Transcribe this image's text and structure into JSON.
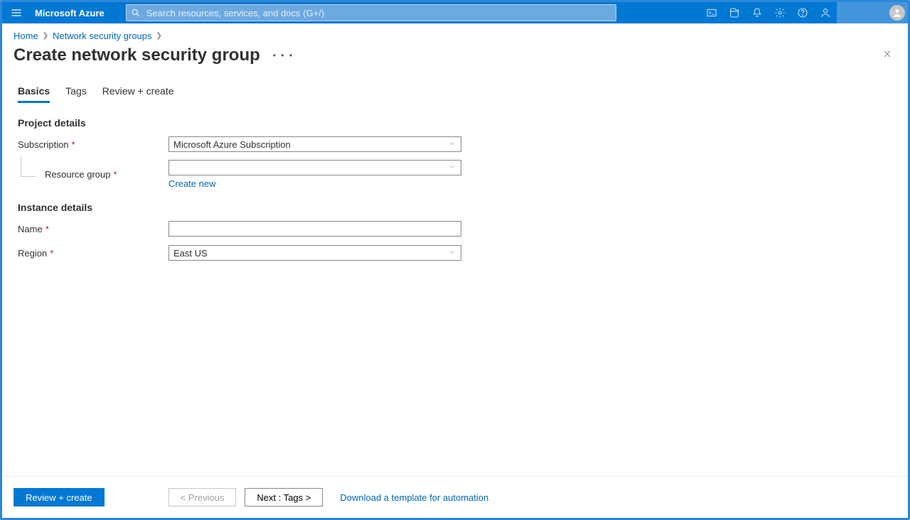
{
  "header": {
    "brand": "Microsoft Azure",
    "search_placeholder": "Search resources, services, and docs (G+/)"
  },
  "breadcrumb": {
    "items": [
      "Home",
      "Network security groups"
    ]
  },
  "page": {
    "title": "Create network security group"
  },
  "tabs": [
    {
      "label": "Basics",
      "active": true
    },
    {
      "label": "Tags",
      "active": false
    },
    {
      "label": "Review + create",
      "active": false
    }
  ],
  "form": {
    "project_section": "Project details",
    "subscription_label": "Subscription",
    "subscription_value": "Microsoft Azure Subscription",
    "rg_label": "Resource group",
    "rg_value": "",
    "rg_create_new": "Create new",
    "instance_section": "Instance details",
    "name_label": "Name",
    "name_value": "",
    "region_label": "Region",
    "region_value": "East US"
  },
  "footer": {
    "review": "Review + create",
    "prev": "< Previous",
    "next": "Next : Tags >",
    "template_link": "Download a template for automation"
  }
}
